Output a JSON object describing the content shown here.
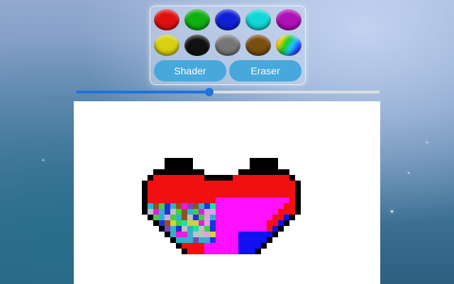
{
  "palette": {
    "colors": [
      {
        "name": "red",
        "hex": "#e01010"
      },
      {
        "name": "green",
        "hex": "#10b010"
      },
      {
        "name": "blue",
        "hex": "#1020d8"
      },
      {
        "name": "cyan",
        "hex": "#10d8d8"
      },
      {
        "name": "magenta",
        "hex": "#b010b8"
      },
      {
        "name": "yellow",
        "hex": "#d8d010"
      },
      {
        "name": "black",
        "hex": "#111111"
      },
      {
        "name": "gray",
        "hex": "#777777"
      },
      {
        "name": "brown",
        "hex": "#7a4e10"
      },
      {
        "name": "rainbow",
        "hex": "rainbow"
      }
    ],
    "shader_label": "Shader",
    "eraser_label": "Eraser"
  },
  "brush_size": {
    "fraction": 0.44
  }
}
